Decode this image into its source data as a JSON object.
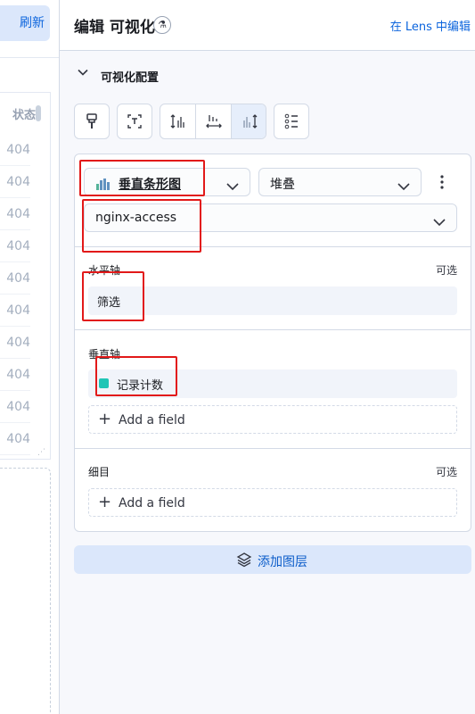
{
  "left": {
    "refresh_label": "刷新",
    "column_header": "状态",
    "rows": [
      "404",
      "404",
      "404",
      "404",
      "404",
      "404",
      "404",
      "404",
      "404",
      "404"
    ]
  },
  "panel": {
    "title": "编辑 可视化",
    "edit_in_lens": "在 Lens 中编辑",
    "config_title": "可视化配置"
  },
  "layer": {
    "chart_type": "垂直条形图",
    "mode": "堆叠",
    "data_view": "nginx-access"
  },
  "horizontal_axis": {
    "label": "水平轴",
    "optional": "可选",
    "field": "筛选"
  },
  "vertical_axis": {
    "label": "垂直轴",
    "field": "记录计数",
    "field_color": "#20c5b6",
    "add_label": "Add a field"
  },
  "breakdown": {
    "label": "细目",
    "optional": "可选",
    "add_label": "Add a field"
  },
  "add_layer_label": "添加图层",
  "colors": {
    "accent": "#0b64dd",
    "highlight": "#e21919"
  }
}
